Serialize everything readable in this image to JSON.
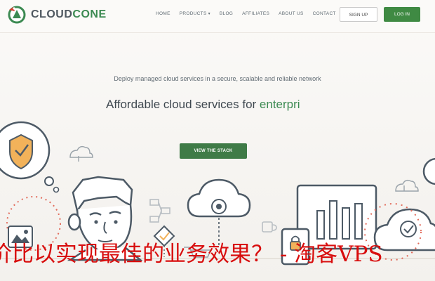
{
  "brand": {
    "logo_text_a": "CLOUD",
    "logo_text_b": "CONE"
  },
  "nav": {
    "items": [
      "HOME",
      "PRODUCTS",
      "BLOG",
      "AFFILIATES",
      "ABOUT US",
      "CONTACT"
    ],
    "products_caret": "▾"
  },
  "auth": {
    "signup_label": "SIGN UP",
    "login_label": "LOG IN"
  },
  "hero": {
    "subtitle": "Deploy managed cloud services in a secure, scalable and reliable network",
    "title_prefix": "Affordable cloud services for ",
    "title_typed": "enterpri",
    "cta_label": "VIEW THE STACK"
  },
  "overlay": {
    "caption": "价比以实现最佳的业务效果？ - 淘客VPS"
  },
  "colors": {
    "brand_green": "#3c8a52",
    "login_green": "#3f8a43",
    "cta_green": "#3f7b47",
    "overlay_red": "#d80d0d",
    "illustration_accent": "#f2b25a"
  }
}
